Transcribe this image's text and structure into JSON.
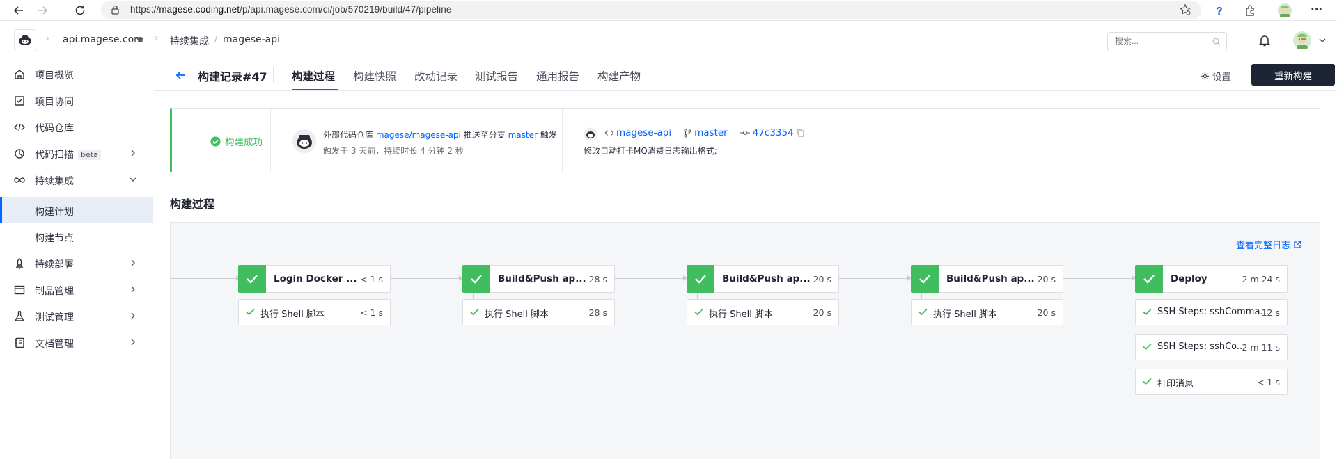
{
  "browser": {
    "url_prefix": "https://",
    "url_host": "magese.coding.net",
    "url_path": "/p/api.magese.com/ci/job/570219/build/47/pipeline",
    "more_label": "···"
  },
  "header": {
    "project": "api.magese.com",
    "crumb_ci": "持续集成",
    "crumb_sep": "/",
    "crumb_repo": "magese-api",
    "search_placeholder": "搜索..."
  },
  "sidebar": {
    "items": [
      {
        "label": "项目概览",
        "icon": "home-icon"
      },
      {
        "label": "项目协同",
        "icon": "task-check-icon"
      },
      {
        "label": "代码仓库",
        "icon": "code-icon"
      },
      {
        "label": "代码扫描",
        "icon": "scan-icon",
        "badge": "beta"
      },
      {
        "label": "持续集成",
        "icon": "infinity-icon"
      },
      {
        "label": "构建计划",
        "icon": ""
      },
      {
        "label": "构建节点",
        "icon": ""
      },
      {
        "label": "持续部署",
        "icon": "rocket-icon"
      },
      {
        "label": "制品管理",
        "icon": "box-icon"
      },
      {
        "label": "测试管理",
        "icon": "flask-icon"
      },
      {
        "label": "文档管理",
        "icon": "document-icon"
      }
    ]
  },
  "subheader": {
    "title": "构建记录#47",
    "tabs": [
      "构建过程",
      "构建快照",
      "改动记录",
      "测试报告",
      "通用报告",
      "构建产物"
    ],
    "settings": "设置",
    "rebuild": "重新构建"
  },
  "status": {
    "text": "构建成功",
    "trigger_prefix": "外部代码仓库",
    "trigger_repo": "magese/magese-api",
    "trigger_mid": "推送至分支",
    "trigger_branch": "master",
    "trigger_suffix": "触发",
    "time_info": "触发于 3 天前，持续时长 4 分钟 2 秒",
    "repo": "magese-api",
    "branch": "master",
    "commit": "47c3354",
    "commit_message": "修改自动打卡MQ消费日志输出格式;"
  },
  "pipeline": {
    "section_title": "构建过程",
    "full_log": "查看完整日志",
    "stages": [
      {
        "name": "Login Docker ...",
        "time": "< 1 s",
        "steps": [
          {
            "name": "执行 Shell 脚本",
            "time": "< 1 s"
          }
        ]
      },
      {
        "name": "Build&Push ap...",
        "time": "28 s",
        "steps": [
          {
            "name": "执行 Shell 脚本",
            "time": "28 s"
          }
        ]
      },
      {
        "name": "Build&Push ap...",
        "time": "20 s",
        "steps": [
          {
            "name": "执行 Shell 脚本",
            "time": "20 s"
          }
        ]
      },
      {
        "name": "Build&Push ap...",
        "time": "20 s",
        "steps": [
          {
            "name": "执行 Shell 脚本",
            "time": "20 s"
          }
        ]
      },
      {
        "name": "Deploy",
        "time": "2 m 24 s",
        "steps": [
          {
            "name": "SSH Steps: sshComma...",
            "time": "12 s"
          },
          {
            "name": "SSH Steps: sshCo...",
            "time": "2 m 11 s"
          },
          {
            "name": "打印消息",
            "time": "< 1 s"
          }
        ]
      }
    ]
  },
  "colors": {
    "accent": "#0066ff",
    "success": "#3fbd5f",
    "dark_button": "#1d2535"
  }
}
